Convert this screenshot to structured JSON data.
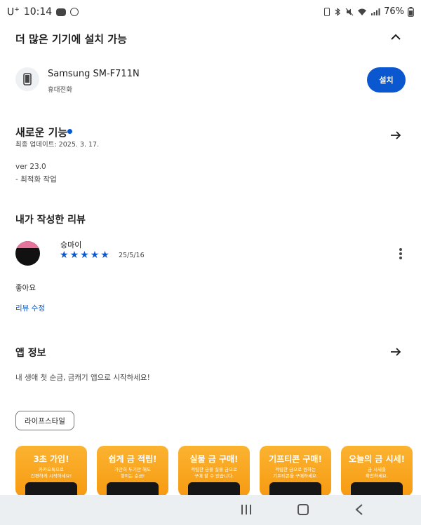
{
  "status_bar": {
    "carrier": "U",
    "carrier_sup": "+",
    "time": "10:14",
    "battery": "76%",
    "icons": [
      "message-icon",
      "alarm-icon",
      "battery-saver-icon",
      "bluetooth-icon",
      "mute-icon",
      "wifi-icon",
      "signal-icon"
    ]
  },
  "install_section": {
    "title": "더 많은 기기에 설치 가능",
    "device_name": "Samsung SM-F711N",
    "device_type": "휴대전화",
    "install_label": "설치"
  },
  "whats_new": {
    "title": "새로운 기능",
    "updated": "최종 업데이트: 2025. 3. 17.",
    "version_line": "ver 23.0",
    "note_line": "- 최적화 작업"
  },
  "my_review": {
    "title": "내가 작성한 리뷰",
    "reviewer": "승마이",
    "rating": 5,
    "date": "25/5/16",
    "text": "좋아요",
    "edit_label": "리뷰 수정"
  },
  "app_info": {
    "title": "앱 정보",
    "description": "내 생애 첫 순금, 금캐기 앱으로 시작하세요!",
    "category": "라이프스타일"
  },
  "screenshots": [
    {
      "title": "3초 가입!",
      "sub1": "카카오톡으로",
      "sub2": "간편하게 시작하세요!"
    },
    {
      "title": "쉽게 금 적립!",
      "sub1": "가만히 두기만 해도",
      "sub2": "쌓이는 순금!"
    },
    {
      "title": "실물 금 구매!",
      "sub1": "적립한 금을 실물 금으로",
      "sub2": "구매 할 수 있습니다."
    },
    {
      "title": "기프티콘 구매!",
      "sub1": "적립한 금으로 원하는",
      "sub2": "기프티콘을 구매하세요."
    },
    {
      "title": "오늘의 금 시세!",
      "sub1": "금 시세를",
      "sub2": "확인하세요."
    }
  ],
  "colors": {
    "accent": "#0b57d0",
    "screenshot_orange": "#f79a12"
  }
}
